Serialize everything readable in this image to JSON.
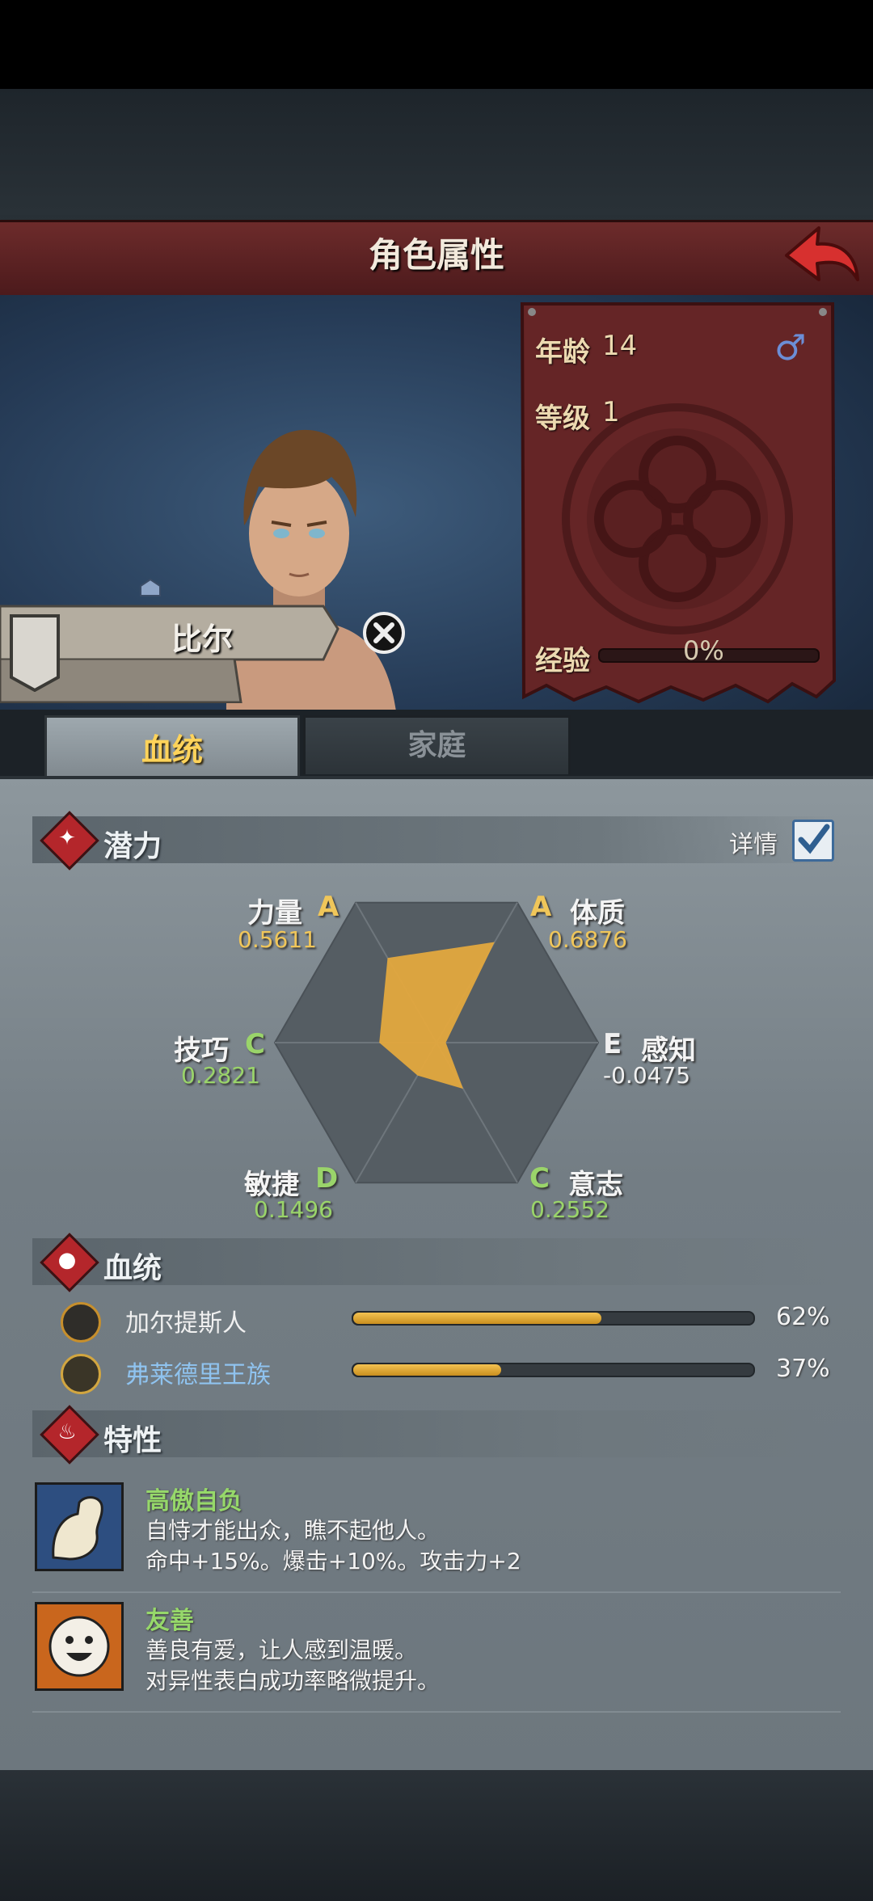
{
  "header": {
    "title": "角色属性"
  },
  "info_panel": {
    "age_label": "年龄",
    "age_value": "14",
    "level_label": "等级",
    "level_value": "1",
    "exp_label": "经验",
    "exp_value": "0%",
    "gender_icon": "male-icon"
  },
  "character": {
    "name": "比尔"
  },
  "tabs": [
    {
      "label": "血统",
      "active": true
    },
    {
      "label": "家庭",
      "active": false
    }
  ],
  "potential": {
    "title": "潜力",
    "detail_label": "详情",
    "stats": [
      {
        "name": "力量",
        "grade": "A",
        "value": "0.5611"
      },
      {
        "name": "体质",
        "grade": "A",
        "value": "0.6876"
      },
      {
        "name": "感知",
        "grade": "E",
        "value": "-0.0475"
      },
      {
        "name": "意志",
        "grade": "C",
        "value": "0.2552"
      },
      {
        "name": "敏捷",
        "grade": "D",
        "value": "0.1496"
      },
      {
        "name": "技巧",
        "grade": "C",
        "value": "0.2821"
      }
    ],
    "colors": {
      "grade_a": "#f0c65a",
      "grade_c": "#9ad46a",
      "grade_d": "#9ad46a",
      "grade_e": "#f0f0f0",
      "radar_fill": "#e3a83e"
    }
  },
  "bloodline": {
    "title": "血统",
    "items": [
      {
        "name": "加尔提斯人",
        "percent": "62%",
        "fraction": 0.62,
        "color": "#f0f0f0"
      },
      {
        "name": "弗莱德里王族",
        "percent": "37%",
        "fraction": 0.37,
        "color": "#8fc3ef"
      }
    ]
  },
  "traits": {
    "title": "特性",
    "items": [
      {
        "name": "高傲自负",
        "lines": [
          "自恃才能出众，瞧不起他人。",
          "命中+15%。爆击+10%。攻击力+2"
        ],
        "icon": "flexed-arm-icon"
      },
      {
        "name": "友善",
        "lines": [
          "善良有爱，让人感到温暖。",
          "对异性表白成功率略微提升。"
        ],
        "icon": "smiley-icon"
      }
    ]
  }
}
